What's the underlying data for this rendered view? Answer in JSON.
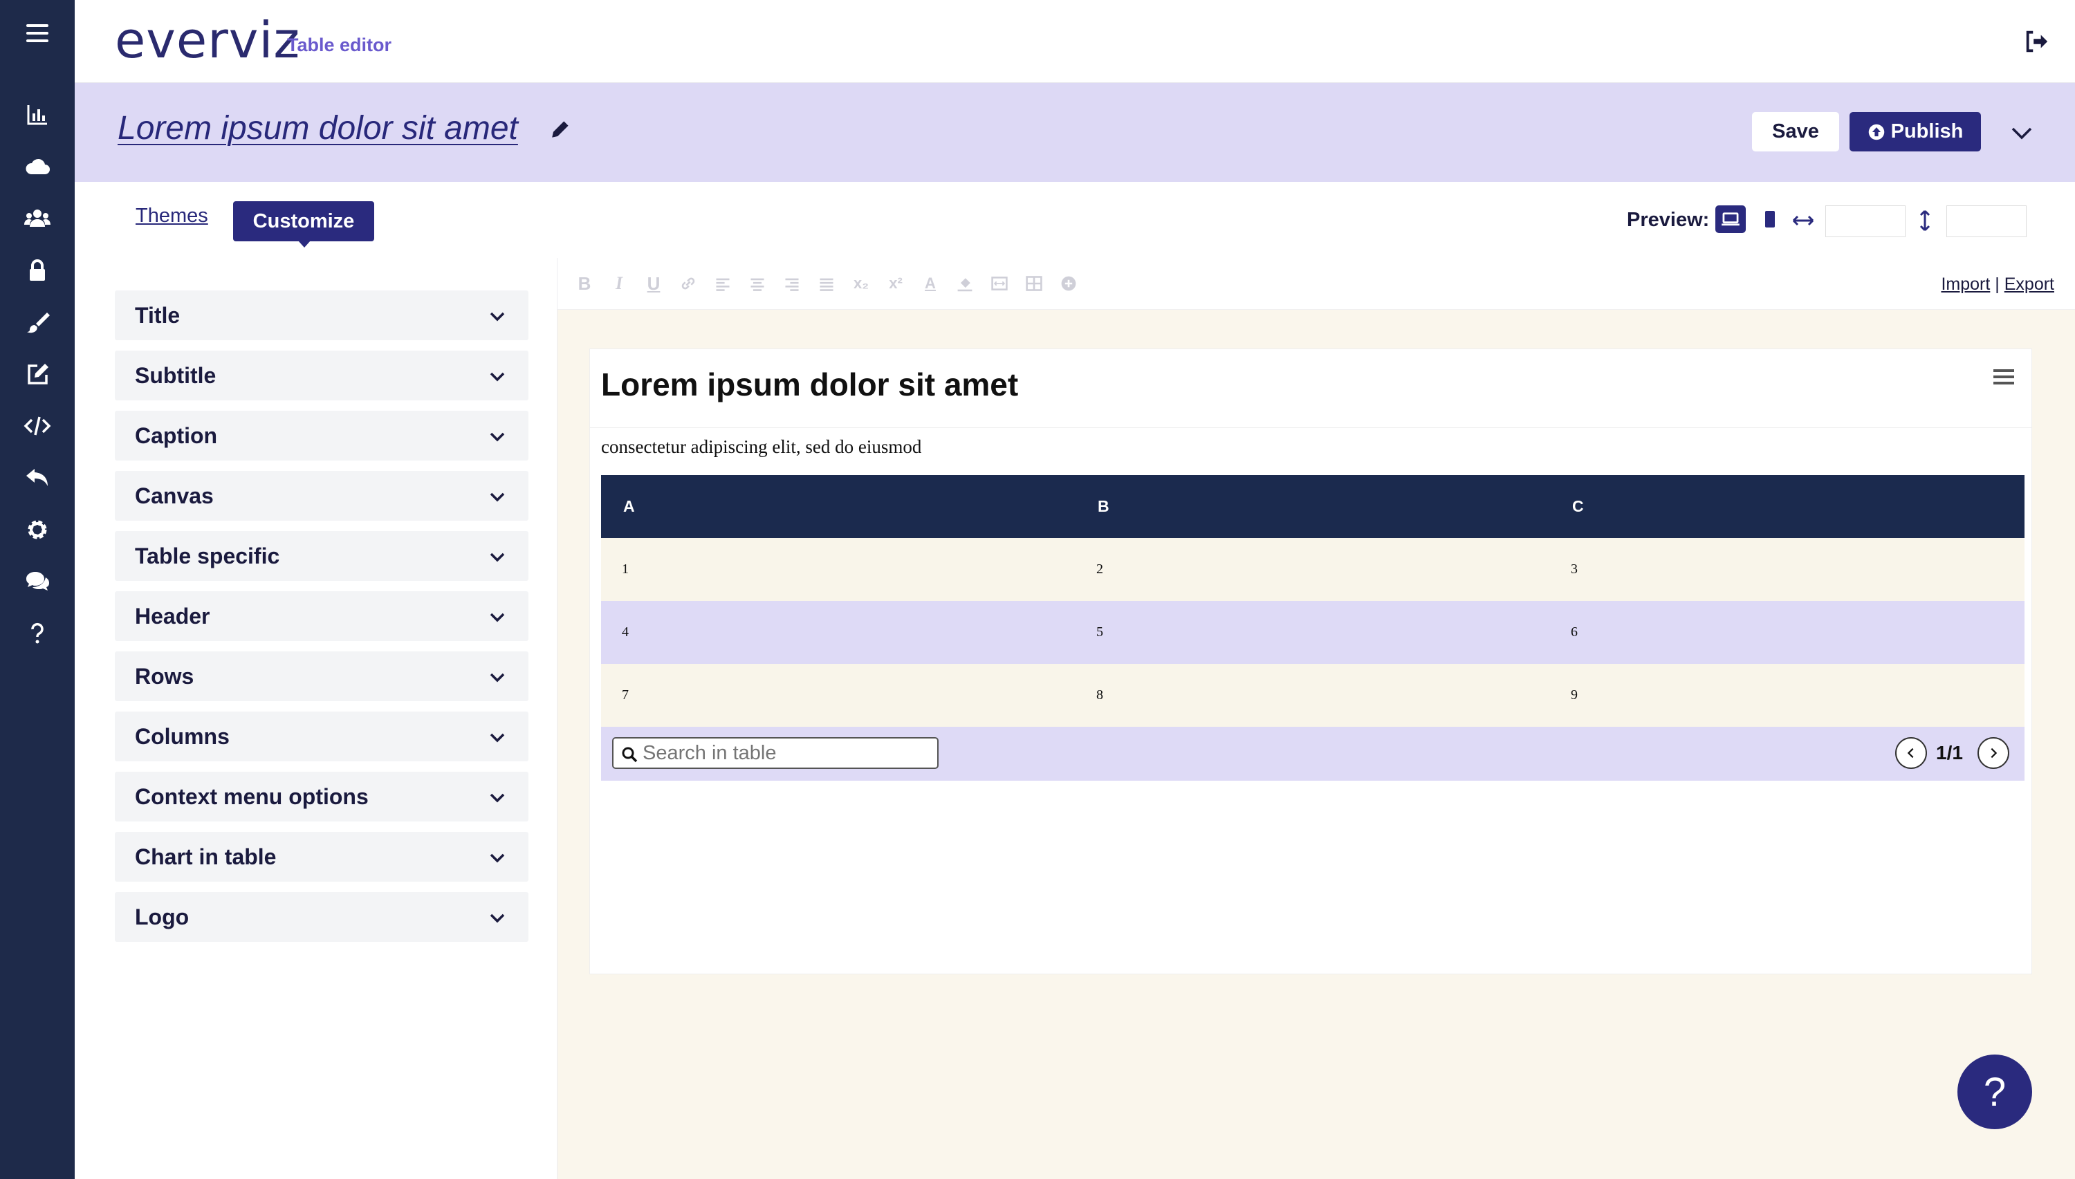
{
  "app": {
    "brand": "everviz",
    "module": "Table editor"
  },
  "sidebar": {
    "icons": [
      "chart-icon",
      "cloud-icon",
      "users-icon",
      "lock-icon",
      "brush-icon",
      "edit-icon",
      "code-icon",
      "reply-icon",
      "gear-icon",
      "chat-icon",
      "help-icon"
    ]
  },
  "header": {
    "doc_title": "Lorem ipsum dolor sit amet",
    "save_label": "Save",
    "publish_label": "Publish"
  },
  "tabs": {
    "themes": "Themes",
    "customize": "Customize",
    "active": "Customize"
  },
  "preview": {
    "label": "Preview:",
    "width": "",
    "height": ""
  },
  "accordion": [
    {
      "label": "Title"
    },
    {
      "label": "Subtitle"
    },
    {
      "label": "Caption"
    },
    {
      "label": "Canvas"
    },
    {
      "label": "Table specific"
    },
    {
      "label": "Header"
    },
    {
      "label": "Rows"
    },
    {
      "label": "Columns"
    },
    {
      "label": "Context menu options"
    },
    {
      "label": "Chart in table"
    },
    {
      "label": "Logo"
    }
  ],
  "toolbar": {
    "import": "Import",
    "separator": "|",
    "export": "Export",
    "tools": [
      "bold-icon",
      "italic-icon",
      "underline-icon",
      "link-icon",
      "align-left-icon",
      "align-center-icon",
      "align-right-icon",
      "justify-icon",
      "subscript-icon",
      "superscript-icon",
      "font-color-icon",
      "fill-color-icon",
      "merge-icon",
      "table-icon",
      "add-icon"
    ]
  },
  "table_preview": {
    "title": "Lorem ipsum dolor sit amet",
    "subtitle": "consectetur adipiscing elit, sed do eiusmod",
    "columns": [
      "A",
      "B",
      "C"
    ],
    "rows": [
      [
        "1",
        "2",
        "3"
      ],
      [
        "4",
        "5",
        "6"
      ],
      [
        "7",
        "8",
        "9"
      ]
    ],
    "search_placeholder": "Search in table",
    "page": "1/1"
  },
  "help": {
    "label": "?"
  },
  "colors": {
    "rail": "#1e2a4a",
    "brand": "#2a2a7e",
    "band": "#ddd9f5",
    "table_header": "#1b2a4e",
    "row_odd": "#f9f5ea",
    "row_even": "#dedaf6",
    "canvas": "#faf6ec"
  }
}
